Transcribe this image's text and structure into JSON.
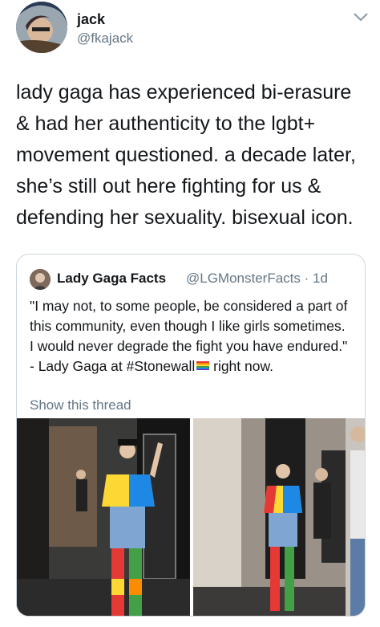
{
  "author": {
    "name": "jack",
    "handle": "@fkajack"
  },
  "tweet": {
    "text": "lady gaga has experienced bi-erasure & had her authenticity to the lgbt+ movement questioned. a decade later, she’s still out here fighting for us & defending her sexuality. bisexual icon."
  },
  "quoted": {
    "name": "Lady Gaga Facts",
    "handle_time": "@LGMonsterFacts · 1d",
    "text": "\"I may not, to some people, be considered a part of this community, even though I like girls sometimes. I would never degrade the fight you have endured.\" - Lady Gaga at #Stonewall",
    "text_tail": " right now.",
    "show_thread": "Show this thread"
  },
  "icons": [
    "avatar",
    "chevron-down-icon",
    "rainbow-flag-emoji"
  ],
  "colors": {
    "secondary_text": "#657786",
    "border": "#ccd6dd"
  }
}
